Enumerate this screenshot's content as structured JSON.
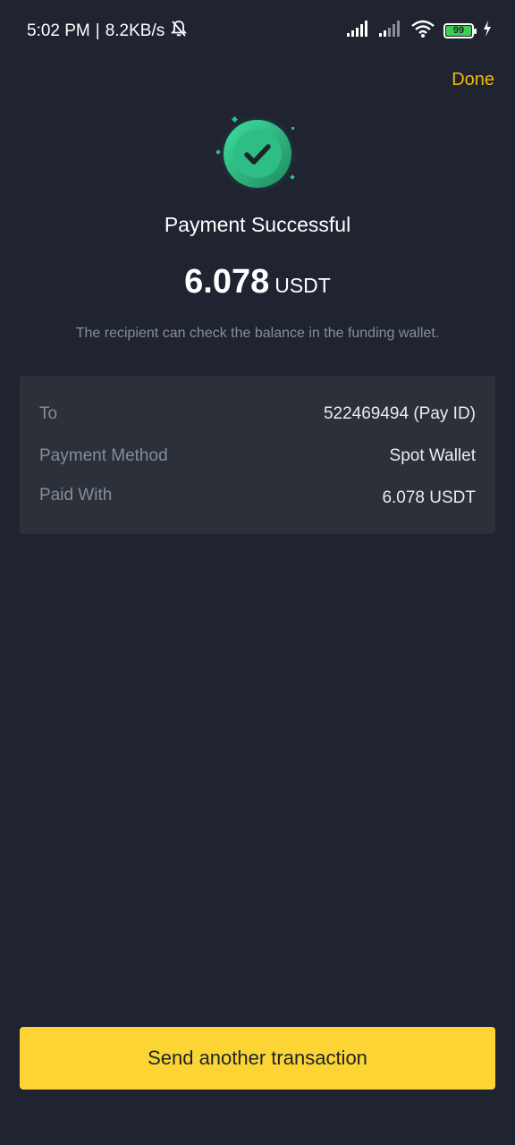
{
  "status_bar": {
    "time": "5:02 PM",
    "separator": "|",
    "network_speed": "8.2KB/s",
    "battery_level": "99",
    "icons": [
      "bell-off-icon",
      "signal-icon",
      "signal-icon",
      "wifi-icon",
      "battery-icon",
      "charging-icon"
    ]
  },
  "header": {
    "done_label": "Done"
  },
  "result": {
    "icon": "check-circle-icon",
    "title": "Payment Successful",
    "amount": "6.078",
    "unit": "USDT",
    "info": "The recipient can check the balance in the funding wallet."
  },
  "details": [
    {
      "label": "To",
      "value": "522469494 (Pay ID)"
    },
    {
      "label": "Payment Method",
      "value": "Spot Wallet"
    },
    {
      "label": "Paid With",
      "value": "6.078 USDT"
    }
  ],
  "footer": {
    "button_label": "Send another transaction"
  },
  "colors": {
    "background": "#1f2430",
    "card": "#2b3039",
    "accent": "#f0b90b",
    "button": "#fcd535",
    "success": "#2ebd85",
    "muted_text": "#848e9c"
  }
}
